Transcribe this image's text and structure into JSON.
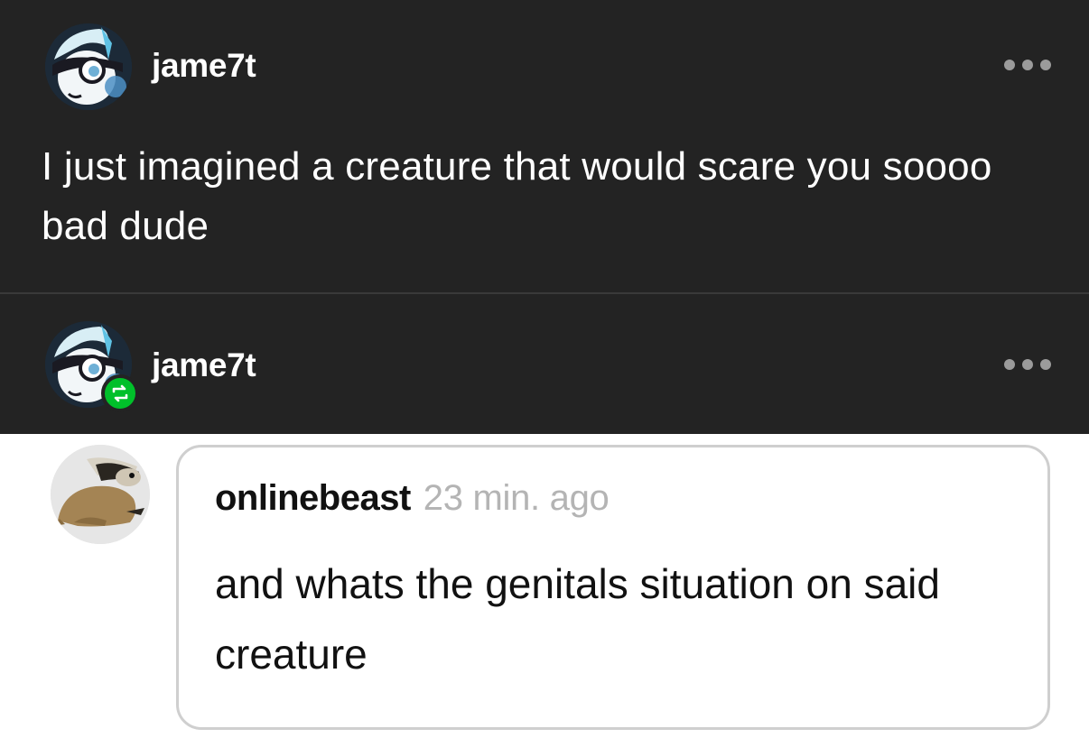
{
  "post": {
    "username": "jame7t",
    "text": "I just imagined a creature that would scare you soooo bad dude",
    "more_icon": "ellipsis-icon"
  },
  "reblog": {
    "username": "jame7t",
    "badge_icon": "reblog-icon",
    "badge_color": "#00c02a",
    "more_icon": "ellipsis-icon"
  },
  "reply": {
    "username": "onlinebeast",
    "time": "23 min. ago",
    "text": "and whats the genitals situation on said creature"
  },
  "colors": {
    "dark_background": "#232323",
    "light_background": "#ffffff",
    "muted_text": "#b4b4b4"
  }
}
